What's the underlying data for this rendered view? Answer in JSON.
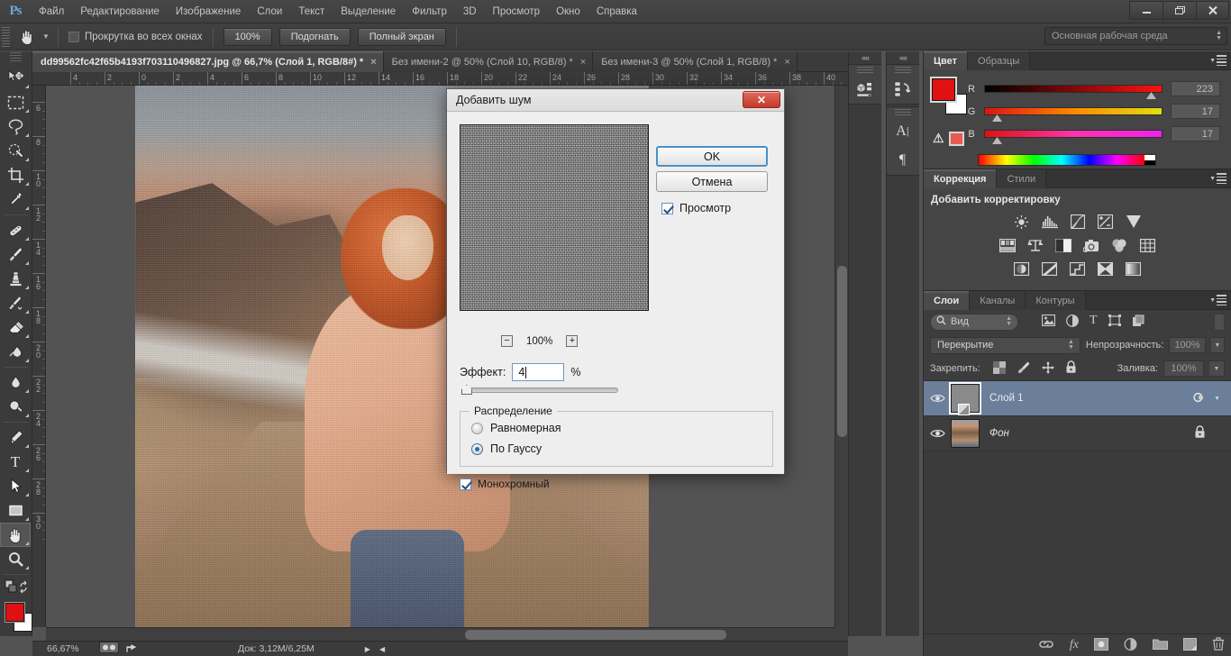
{
  "app": {
    "logo": "Ps",
    "menus": [
      "Файл",
      "Редактирование",
      "Изображение",
      "Слои",
      "Текст",
      "Выделение",
      "Фильтр",
      "3D",
      "Просмотр",
      "Окно",
      "Справка"
    ]
  },
  "window_controls": {
    "minimize": "minimize-icon",
    "restore": "restore-icon",
    "close": "close-icon"
  },
  "options_bar": {
    "tool_icon": "hand-tool-icon",
    "scroll_all_windows": {
      "label": "Прокрутка во всех окнах",
      "checked": false
    },
    "buttons": [
      "100%",
      "Подогнать",
      "Полный экран"
    ],
    "workspace": "Основная рабочая среда"
  },
  "tabs": [
    {
      "title": "dd99562fc42f65b4193f703110496827.jpg @ 66,7% (Слой 1, RGB/8#) *",
      "active": true,
      "close": "×"
    },
    {
      "title": "Без имени-2 @ 50% (Слой 10, RGB/8) *",
      "active": false,
      "close": "×"
    },
    {
      "title": "Без имени-3 @ 50% (Слой 1, RGB/8) *",
      "active": false,
      "close": "×"
    }
  ],
  "rulers": {
    "horizontal": [
      "4",
      "2",
      "0",
      "2",
      "4",
      "6",
      "8",
      "10",
      "12",
      "14",
      "16",
      "18",
      "20",
      "22",
      "24",
      "26",
      "28",
      "30",
      "32",
      "34",
      "36",
      "38",
      "40"
    ],
    "vertical": [
      "6",
      "8",
      "1 0",
      "1 2",
      "1 4",
      "1 6",
      "1 8",
      "2 0",
      "2 2",
      "2 4",
      "2 6",
      "2 8",
      "3 0"
    ]
  },
  "toolbar": {
    "tools": [
      {
        "name": "move-tool",
        "glyph": "move"
      },
      {
        "name": "marquee-tool",
        "glyph": "marquee"
      },
      {
        "name": "lasso-tool",
        "glyph": "lasso"
      },
      {
        "name": "quick-selection-tool",
        "glyph": "quickselect"
      },
      {
        "name": "crop-tool",
        "glyph": "crop"
      },
      {
        "name": "eyedropper-tool",
        "glyph": "eyedropper"
      },
      {
        "name": "healing-brush-tool",
        "glyph": "healing"
      },
      {
        "name": "brush-tool",
        "glyph": "brush"
      },
      {
        "name": "clone-stamp-tool",
        "glyph": "stamp"
      },
      {
        "name": "history-brush-tool",
        "glyph": "historybrush"
      },
      {
        "name": "eraser-tool",
        "glyph": "eraser"
      },
      {
        "name": "gradient-tool",
        "glyph": "gradient"
      },
      {
        "name": "blur-tool",
        "glyph": "blur"
      },
      {
        "name": "dodge-tool",
        "glyph": "dodge"
      },
      {
        "name": "pen-tool",
        "glyph": "pen"
      },
      {
        "name": "type-tool",
        "glyph": "type"
      },
      {
        "name": "path-selection-tool",
        "glyph": "pathselect"
      },
      {
        "name": "shape-tool",
        "glyph": "shape"
      },
      {
        "name": "hand-tool",
        "glyph": "hand",
        "active": true
      },
      {
        "name": "zoom-tool",
        "glyph": "zoom"
      }
    ],
    "foreground_color": "#df1111",
    "background_color": "#ffffff"
  },
  "status_bar": {
    "zoom": "66,67%",
    "doc_info": "Док: 3,12M/6,25M"
  },
  "dock_icons": {
    "collapse": "««",
    "column1": [
      "3d-panel-icon"
    ],
    "column2": [
      "history-panel-icon",
      "character-panel-icon",
      "paragraph-panel-icon"
    ]
  },
  "color_panel": {
    "tabs": [
      "Цвет",
      "Образцы"
    ],
    "active_tab": "Цвет",
    "channels": [
      {
        "label": "R",
        "value": "223"
      },
      {
        "label": "G",
        "value": "17"
      },
      {
        "label": "B",
        "value": "17"
      }
    ],
    "foreground": "#df1111",
    "background": "#ffffff"
  },
  "adjustments_panel": {
    "tabs": [
      "Коррекция",
      "Стили"
    ],
    "active_tab": "Коррекция",
    "title": "Добавить корректировку",
    "row1": [
      "brightness-contrast-icon",
      "levels-icon",
      "curves-icon",
      "exposure-icon",
      "vibrance-icon"
    ],
    "row2": [
      "hue-saturation-icon",
      "color-balance-icon",
      "black-white-icon",
      "photo-filter-icon",
      "channel-mixer-icon",
      "color-lookup-icon"
    ],
    "row3": [
      "invert-icon",
      "posterize-icon",
      "threshold-icon",
      "selective-color-icon",
      "gradient-map-icon"
    ]
  },
  "layers_panel": {
    "tabs": [
      "Слои",
      "Каналы",
      "Контуры"
    ],
    "active_tab": "Слои",
    "filter": {
      "label": "Вид",
      "icon": "search-icon"
    },
    "filter_type_icons": [
      "pixel-filter-icon",
      "adjustment-filter-icon",
      "type-filter-icon",
      "shape-filter-icon",
      "smartobject-filter-icon"
    ],
    "blend_mode": "Перекрытие",
    "opacity_label": "Непрозрачность:",
    "opacity_value": "100%",
    "lock_label": "Закрепить:",
    "lock_icons": [
      "lock-transparency-icon",
      "lock-image-icon",
      "lock-position-icon",
      "lock-all-icon"
    ],
    "fill_label": "Заливка:",
    "fill_value": "100%",
    "layers": [
      {
        "name": "Слой 1",
        "visible": true,
        "selected": true,
        "italic": false,
        "has_mask": true,
        "fx": "fx-style-icon"
      },
      {
        "name": "Фон",
        "visible": true,
        "selected": false,
        "italic": true,
        "locked": true
      }
    ],
    "footer_icons": [
      "link-layers-icon",
      "add-style-icon",
      "add-mask-icon",
      "new-adjustment-icon",
      "new-group-icon",
      "new-layer-icon",
      "delete-layer-icon"
    ]
  },
  "dialog": {
    "title": "Добавить шум",
    "close": "✕",
    "ok": "OK",
    "cancel": "Отмена",
    "preview_checkbox": {
      "label": "Просмотр",
      "checked": true
    },
    "zoom": {
      "minus": "−",
      "value": "100%",
      "plus": "+"
    },
    "effect": {
      "label": "Эффект:",
      "value": "4",
      "unit": "%"
    },
    "distribution": {
      "legend": "Распределение",
      "options": [
        {
          "label": "Равномерная",
          "selected": false
        },
        {
          "label": "По Гауссу",
          "selected": true
        }
      ]
    },
    "monochrome": {
      "label": "Монохромный",
      "checked": true
    }
  }
}
